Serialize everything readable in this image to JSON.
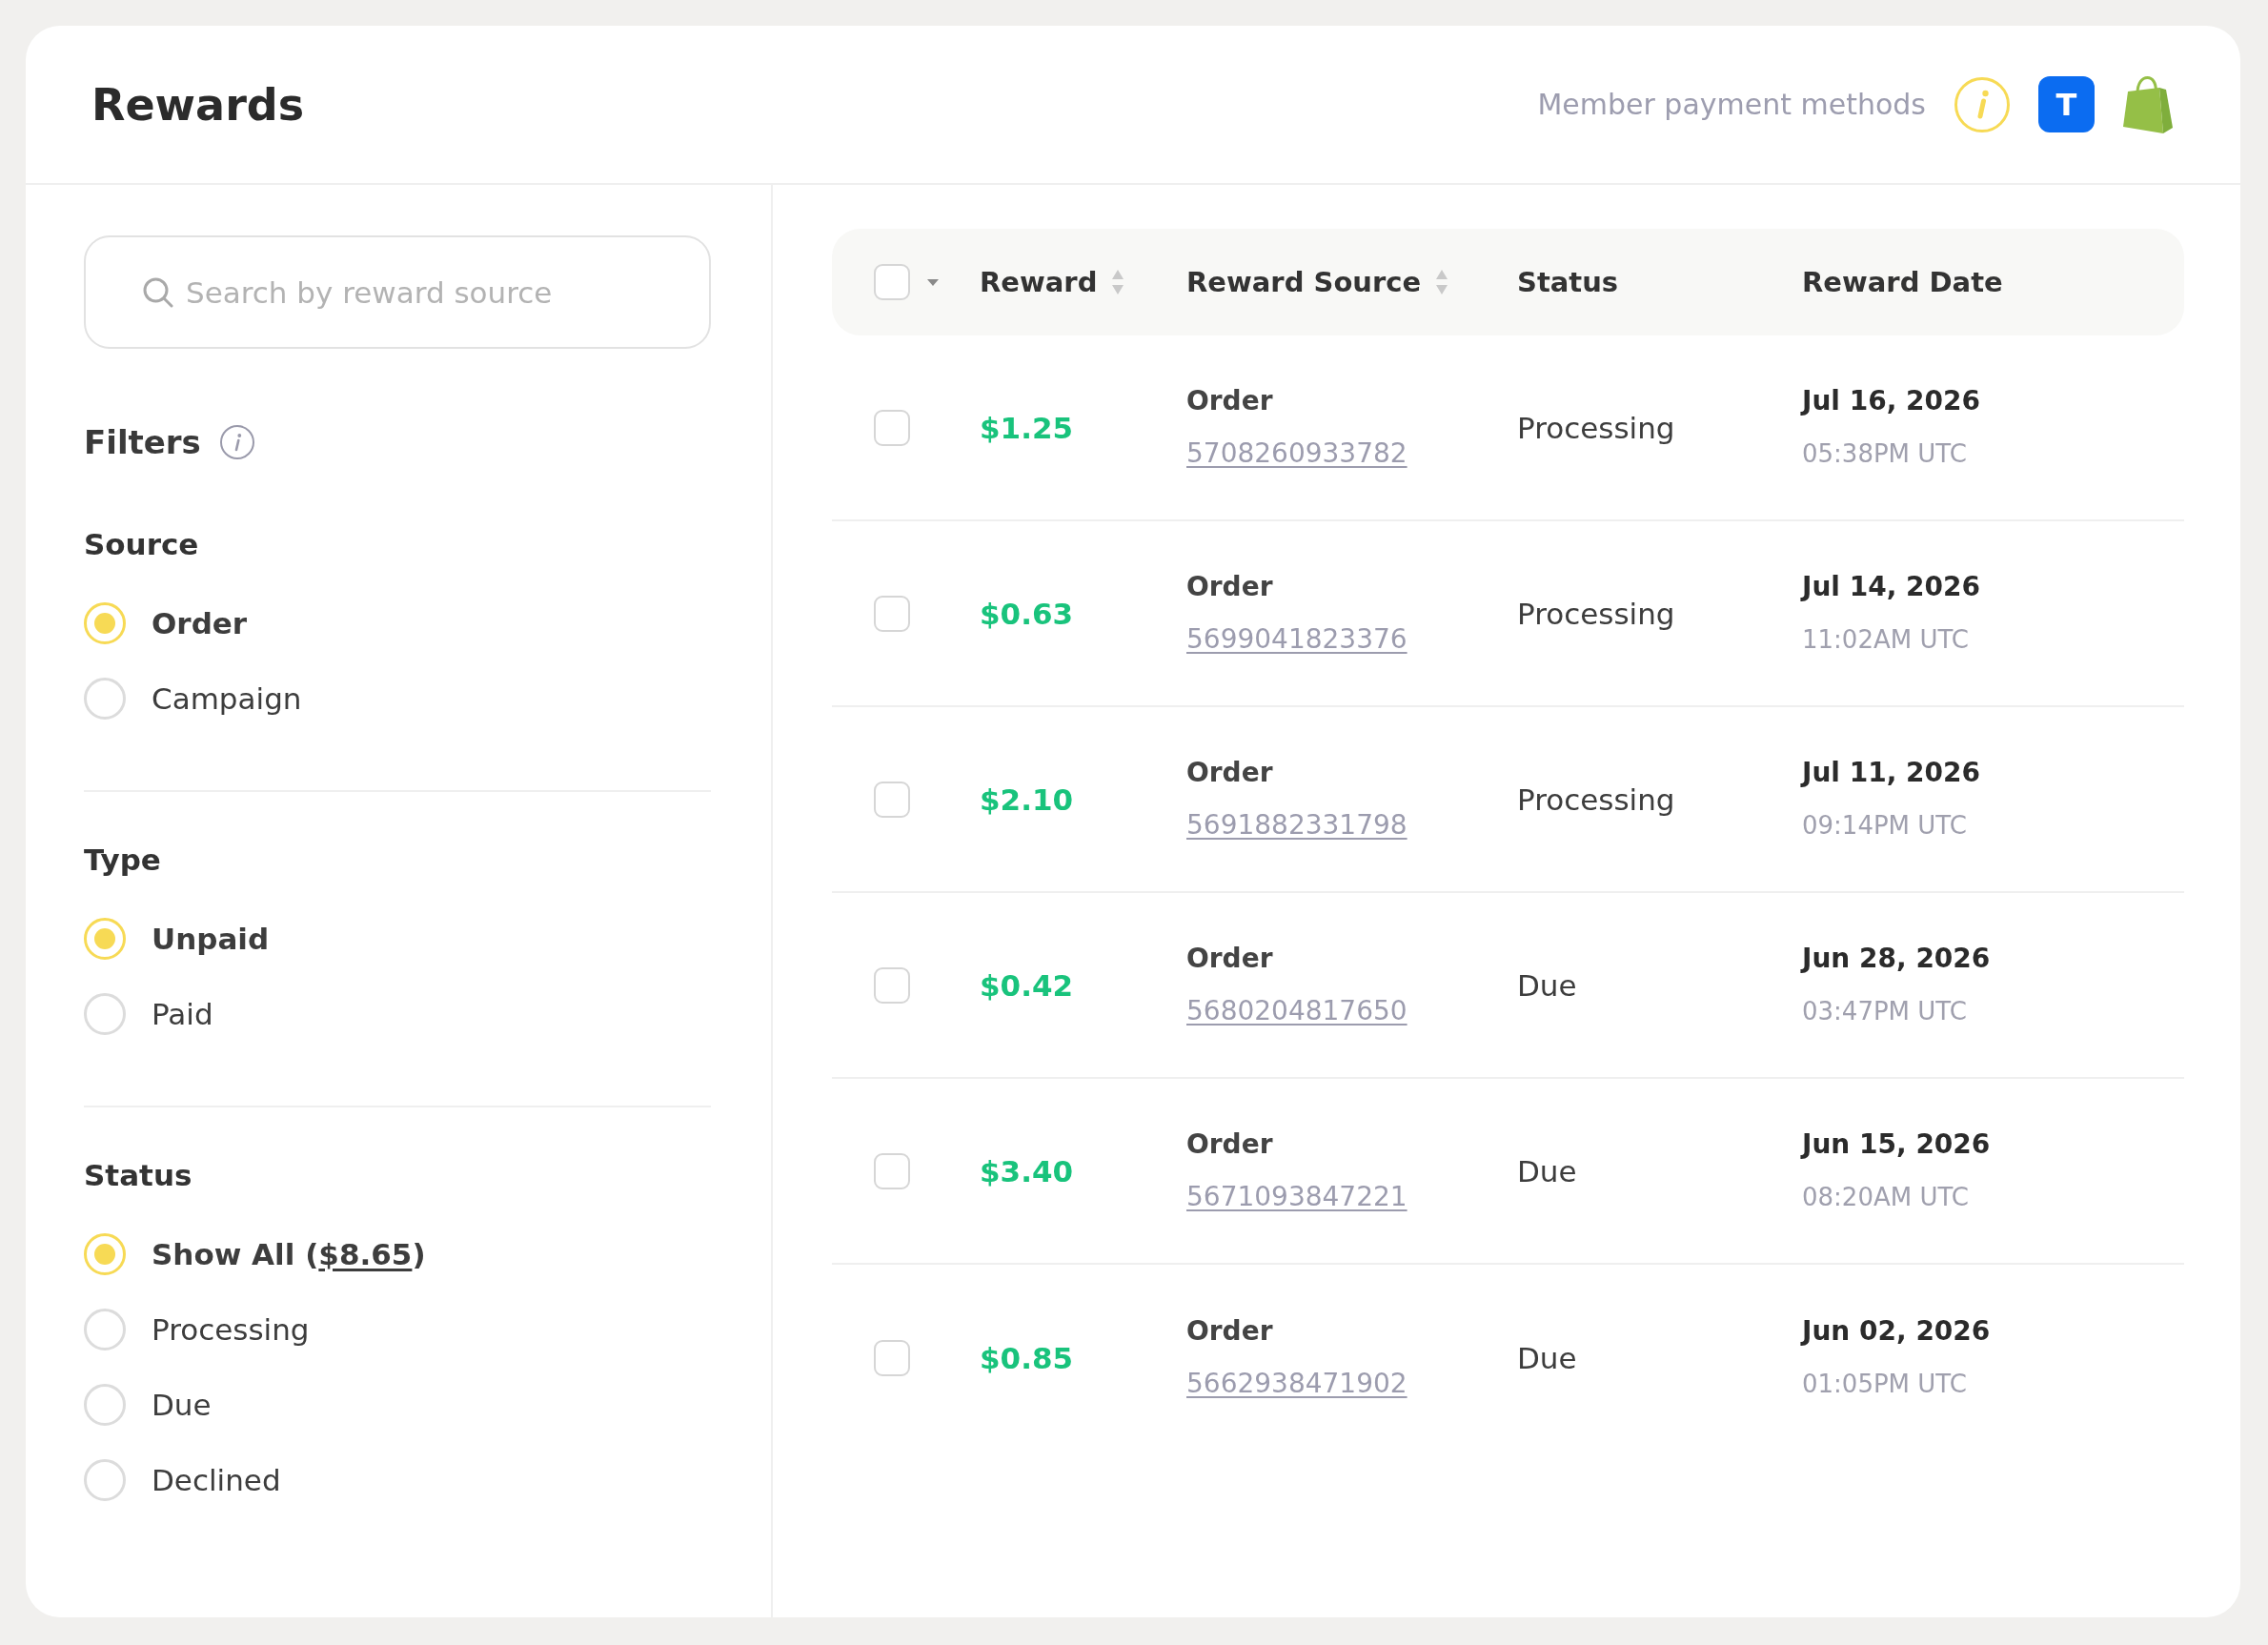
{
  "header": {
    "title": "Rewards",
    "payment_methods_label": "Member payment methods",
    "letter_tile": "T"
  },
  "sidebar": {
    "search": {
      "placeholder": "Search by reward source"
    },
    "filters_title": "Filters",
    "filter_groups": [
      {
        "title": "Source",
        "options": [
          {
            "label": "Order",
            "selected": true
          },
          {
            "label": "Campaign",
            "selected": false
          }
        ]
      },
      {
        "title": "Type",
        "options": [
          {
            "label": "Unpaid",
            "selected": true
          },
          {
            "label": "Paid",
            "selected": false
          }
        ]
      },
      {
        "title": "Status",
        "options": [
          {
            "label": "Show All (",
            "link": "$8.65",
            "label_end": ")",
            "selected": true
          },
          {
            "label": "Processing",
            "selected": false
          },
          {
            "label": "Due",
            "selected": false
          },
          {
            "label": "Declined",
            "selected": false
          }
        ]
      }
    ]
  },
  "table": {
    "select_all": {
      "checked": false
    },
    "columns": [
      {
        "label": "Reward",
        "sortable": true
      },
      {
        "label": "Reward Source",
        "sortable": true
      },
      {
        "label": "Status",
        "sortable": false
      },
      {
        "label": "Reward Date",
        "sortable": false
      }
    ],
    "rows": [
      {
        "checked": false,
        "reward": "$1.25",
        "source_type": "Order",
        "source_id": "5708260933782",
        "status": "Processing",
        "date": "Jul 16, 2026",
        "time": "05:38PM UTC"
      },
      {
        "checked": false,
        "reward": "$0.63",
        "source_type": "Order",
        "source_id": "5699041823376",
        "status": "Processing",
        "date": "Jul 14, 2026",
        "time": "11:02AM UTC"
      },
      {
        "checked": false,
        "reward": "$2.10",
        "source_type": "Order",
        "source_id": "5691882331798",
        "status": "Processing",
        "date": "Jul 11, 2026",
        "time": "09:14PM UTC"
      },
      {
        "checked": false,
        "reward": "$0.42",
        "source_type": "Order",
        "source_id": "5680204817650",
        "status": "Due",
        "date": "Jun 28, 2026",
        "time": "03:47PM UTC"
      },
      {
        "checked": false,
        "reward": "$3.40",
        "source_type": "Order",
        "source_id": "5671093847221",
        "status": "Due",
        "date": "Jun 15, 2026",
        "time": "08:20AM UTC"
      },
      {
        "checked": false,
        "reward": "$0.85",
        "source_type": "Order",
        "source_id": "5662938471902",
        "status": "Due",
        "date": "Jun 02, 2026",
        "time": "01:05PM UTC"
      }
    ]
  }
}
